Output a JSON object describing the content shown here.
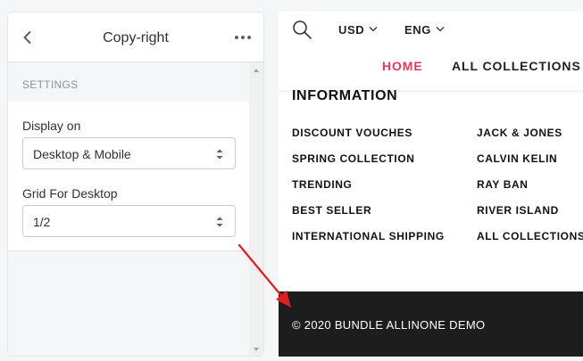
{
  "editor": {
    "title": "Copy-right",
    "back_icon": "chevron-left-icon",
    "more_icon": "ellipsis-icon",
    "section_label": "SETTINGS",
    "fields": [
      {
        "label": "Display on",
        "value": "Desktop & Mobile"
      },
      {
        "label": "Grid For Desktop",
        "value": "1/2"
      }
    ]
  },
  "preview": {
    "search_icon": "search-icon",
    "currency": "USD",
    "language": "ENG",
    "nav": [
      {
        "label": "HOME",
        "active": true
      },
      {
        "label": "ALL COLLECTIONS",
        "active": false
      }
    ],
    "info_title": "INFORMATION",
    "links_left": [
      "DISCOUNT VOUCHES",
      "SPRING COLLECTION",
      "TRENDING",
      "BEST SELLER",
      "INTERNATIONAL SHIPPING"
    ],
    "links_right": [
      "JACK & JONES",
      "CALVIN KELIN",
      "RAY BAN",
      "RIVER ISLAND",
      "ALL COLLECTIONS"
    ],
    "copyright": "© 2020 BUNDLE ALLINONE DEMO"
  },
  "colors": {
    "accent_pink": "#e8385c",
    "annotation_red": "#e02020",
    "footer_bg": "#1d1d1d",
    "nav_default": "#222222"
  }
}
